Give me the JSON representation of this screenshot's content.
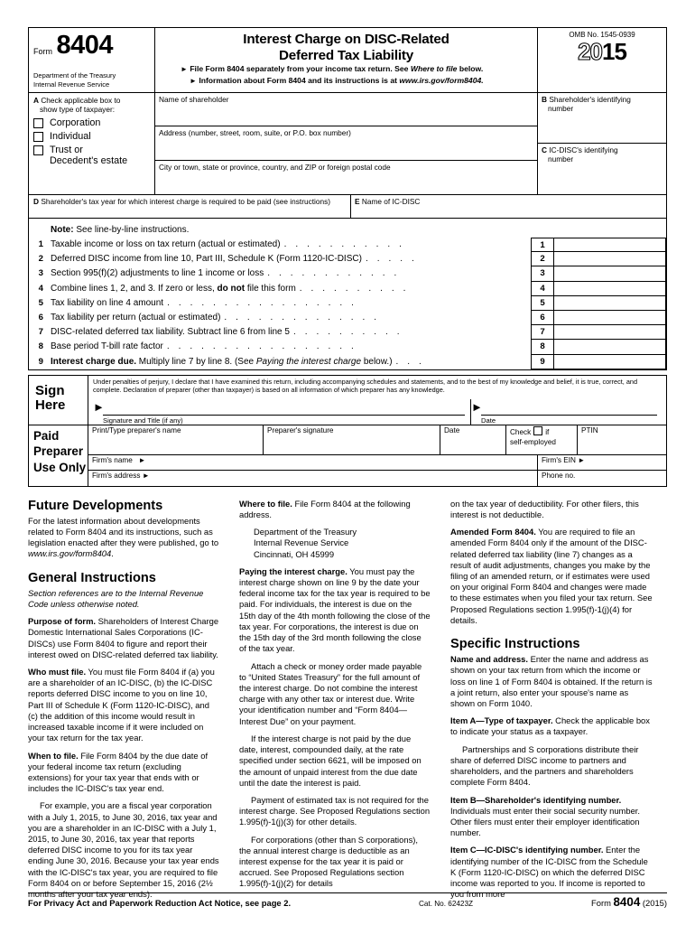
{
  "header": {
    "form_word": "Form",
    "form_number": "8404",
    "department": "Department of the Treasury",
    "service": "Internal Revenue Service",
    "title_line1": "Interest Charge on DISC-Related",
    "title_line2": "Deferred Tax Liability",
    "bullet1": "File Form 8404 separately from your income tax return. See Where to file below.",
    "bullet1_plain": "File Form 8404 separately from your income tax return. See ",
    "bullet1_italic": "Where to file",
    "bullet1_tail": " below.",
    "bullet2_plain": "Information about Form 8404 and its instructions is at ",
    "bullet2_italic": "www.irs.gov/form8404.",
    "omb": "OMB No. 1545-0939",
    "year_hollow": "20",
    "year_solid": "15"
  },
  "entity": {
    "a_letter": "A",
    "a_label_line1": "Check applicable box to",
    "a_label_line2": "show type of taxpayer:",
    "checkboxes": [
      {
        "label": "Corporation"
      },
      {
        "label": "Individual"
      },
      {
        "label": "Trust or\nDecedent's estate"
      }
    ],
    "cb_trust_line1": "Trust or",
    "cb_trust_line2": "Decedent's estate",
    "name_field": "Name of shareholder",
    "address_field": "Address (number, street, room, suite, or P.O. box number)",
    "city_field": "City or town, state or province, country, and ZIP or foreign postal code",
    "b_letter": "B",
    "b_label_line1": "Shareholder's identifying",
    "b_label_line2": "number",
    "c_letter": "C",
    "c_label_line1": "IC-DISC's identifying",
    "c_label_line2": "number",
    "d_letter": "D",
    "d_label": "Shareholder's tax year for which interest charge is required to be paid (see instructions)",
    "e_letter": "E",
    "e_label": "Name of IC-DISC"
  },
  "body": {
    "note_bold": "Note:",
    "note_text": " See line-by-line instructions.",
    "lines": [
      {
        "no": "1",
        "text": "Taxable income or loss on tax return (actual or estimated)",
        "dots": ". . . . . . . . . . ."
      },
      {
        "no": "2",
        "text": "Deferred DISC income from line 10, Part III, Schedule K (Form 1120-IC-DISC)",
        "dots": ". . . . ."
      },
      {
        "no": "3",
        "text": "Section 995(f)(2) adjustments to line 1 income or loss",
        "dots": ". . . . . . . . . . . ."
      },
      {
        "no": "4",
        "text": "Combine lines 1, 2, and 3. If zero or less, do not file this form",
        "dots": ". . . . . . . . . ."
      },
      {
        "no": "5",
        "text": "Tax liability on line 4 amount",
        "dots": ". . . . . . . . . . . . . . . . ."
      },
      {
        "no": "6",
        "text": "Tax liability per return (actual or estimated)",
        "dots": ". . . . . . . . . . . . . ."
      },
      {
        "no": "7",
        "text": "DISC-related deferred tax liability. Subtract line 6 from line 5",
        "dots": ". . . . . . . . . ."
      },
      {
        "no": "8",
        "text": "Base period T-bill rate factor",
        "dots": ". . . . . . . . . . . . . . . . ."
      },
      {
        "no": "9",
        "text": "Interest charge due. Multiply line 7 by line 8. (See Paying the interest charge below.)",
        "dots": ". . ."
      }
    ],
    "line4_pre": "Combine lines 1, 2, and 3. If zero or less, ",
    "line4_bold": "do not",
    "line4_post": " file this form",
    "line7_bold": "DISC-related deferred tax liability.",
    "line7_post": " Subtract line 6 from line 5",
    "line9_bold": "Interest charge due.",
    "line9_mid": " Multiply line 7 by line 8. (See ",
    "line9_italic": "Paying the interest charge",
    "line9_tail": " below.)"
  },
  "sign": {
    "label_line1": "Sign",
    "label_line2": "Here",
    "perjury": "Under penalties of perjury, I declare that I have examined this return, including accompanying schedules and statements, and to the best of my knowledge and belief, it is true, correct, and complete. Declaration of preparer (other than taxpayer) is based on all information of which preparer has any knowledge.",
    "signature_label": "Signature and Title (if any)",
    "date_label": "Date"
  },
  "preparer": {
    "label_line1": "Paid",
    "label_line2": "Preparer",
    "label_line3": "Use Only",
    "print_name": "Print/Type preparer's name",
    "signature": "Preparer's signature",
    "date": "Date",
    "check_pre": "Check",
    "check_post": "if",
    "self_employed": "self-employed",
    "ptin": "PTIN",
    "firm_name": "Firm's name",
    "firm_ein": "Firm's EIN",
    "firm_address": "Firm's address",
    "phone_no": "Phone no."
  },
  "instructions": {
    "col1": {
      "h_future": "Future Developments",
      "p_future_pre": "For the latest information about developments related to Form 8404 and its instructions, such as legislation enacted after they were published, go to ",
      "p_future_italic": "www.irs.gov/form8404",
      "p_future_post": ".",
      "h_general": "General Instructions",
      "p_section_italic": "Section references are to the Internal Revenue Code unless otherwise noted.",
      "purpose_bold": "Purpose of form.",
      "purpose_text": " Shareholders of Interest Charge Domestic International Sales Corporations (IC-DISCs) use Form 8404 to figure and report their interest owed on DISC-related deferred tax liability.",
      "who_bold": "Who must file.",
      "who_text": " You must file Form 8404 if (a) you are a shareholder of an IC-DISC, (b) the IC-DISC reports deferred DISC income to you on line 10, Part III of Schedule K (Form 1120-IC-DISC), and (c) the addition of this income would result in increased taxable income if it were included on your tax return for the tax year.",
      "when_bold": "When to file.",
      "when_text": " File Form 8404 by the due date of your federal income tax return (excluding extensions) for your tax year that ends with or includes the IC-DISC's tax year end.",
      "example_text": "For example, you are a fiscal year corporation with a July 1, 2015, to June 30, 2016, tax year and you are a shareholder in an IC-DISC with a July 1, 2015, to June 30, 2016, tax year that reports deferred DISC income to you for its tax year ending June 30, 2016. Because your tax year ends with the IC-DISC's tax year, you are required to file Form 8404 on or before September 15, 2016 (2½ months after your tax year ends)."
    },
    "col2": {
      "where_bold": "Where to file.",
      "where_text": " File Form 8404 at the following address.",
      "addr_line1": "Department of the Treasury",
      "addr_line2": "Internal Revenue Service",
      "addr_line3": "Cincinnati, OH 45999",
      "paying_bold": "Paying the interest charge.",
      "paying_text": " You must pay the interest charge shown on line 9 by the date your federal income tax for the tax year is required to be paid. For individuals, the interest is due on the 15th day of the 4th month following the close of the tax year. For corporations, the interest is due on the 15th day of the 3rd month following the close of the tax year.",
      "attach_text": "Attach a check or money order made payable to “United States Treasury” for the full amount of the interest charge. Do not combine the interest charge with any other tax or interest due. Write your identification number and “Form 8404—Interest Due” on your payment.",
      "ifnotpaid_text": "If the interest charge is not paid by the due date, interest, compounded daily, at the rate specified under section 6621, will be imposed on the amount of unpaid interest from the due date until the date the interest is paid.",
      "payment_text": "Payment of estimated tax is not required for the interest charge. See Proposed Regulations section 1.995(f)-1(j)(3) for other details.",
      "forcorp_text": "For corporations (other than S corporations), the annual interest charge is deductible as an interest expense for the tax year it is paid or accrued. See Proposed Regulations section 1.995(f)-1(j)(2) for details"
    },
    "col3": {
      "cont_text": "on the tax year of deductibility. For other filers, this interest is not deductible.",
      "amended_bold": "Amended Form 8404.",
      "amended_text": " You are required to file an amended Form 8404 only if the amount of the DISC-related deferred tax liability (line 7) changes as a result of audit adjustments, changes you make by the filing of an amended return, or if estimates were used on your original Form 8404 and changes were made to these estimates when you filed your tax return. See Proposed Regulations section 1.995(f)-1(j)(4) for details.",
      "h_specific": "Specific Instructions",
      "name_bold": "Name and address.",
      "name_text": " Enter the name and address as shown on your tax return from which the income or loss on line 1 of Form 8404 is obtained. If the return is a joint return, also enter your spouse's name as shown on Form 1040.",
      "itemA_bold": "Item A—Type of taxpayer.",
      "itemA_text": " Check the applicable box to indicate your status as a taxpayer.",
      "partnerships_text": "Partnerships and S corporations distribute their share of deferred DISC income to partners and shareholders, and the partners and shareholders complete Form 8404.",
      "itemB_bold": "Item B—Shareholder's identifying number.",
      "itemB_text": " Individuals must enter their social security number. Other filers must enter their employer identification number.",
      "itemC_bold": "Item C—IC-DISC's identifying number.",
      "itemC_text": " Enter the identifying number of the IC-DISC from the Schedule K (Form 1120-IC-DISC) on which the deferred DISC income was reported to you. If income is reported to you from more"
    }
  },
  "footer": {
    "privacy": "For Privacy Act and Paperwork Reduction Act Notice, see page 2.",
    "cat_no": "Cat. No. 62423Z",
    "form_word": "Form",
    "form_number": "8404",
    "form_year": "(2015)"
  }
}
